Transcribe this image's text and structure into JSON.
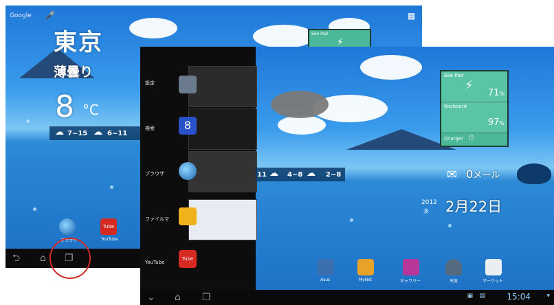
{
  "screenshot_a": {
    "search_label": "Google",
    "weather": {
      "city": "東京",
      "condition": "薄曇り",
      "temperature": "8",
      "unit": "°C",
      "forecast": [
        "7~15",
        "6~11"
      ]
    },
    "battery": {
      "title": "Eee Pad"
    },
    "dock": [
      {
        "label": "ブラウザ",
        "icon": "globe-icon"
      },
      {
        "label": "YouTube",
        "icon": "youtube-icon"
      }
    ],
    "nav": [
      "back-icon",
      "home-icon",
      "recent-apps-icon"
    ]
  },
  "screenshot_b": {
    "recent_apps": [
      {
        "label": "設定",
        "icon": "settings-icon"
      },
      {
        "label": "検索",
        "icon": "google-search-icon"
      },
      {
        "label": "ブラウザ",
        "icon": "globe-icon"
      },
      {
        "label": "ファイルマ",
        "icon": "folder-icon"
      },
      {
        "label": "YouTube",
        "icon": "youtube-icon"
      }
    ],
    "battery": {
      "title": "Eee Pad",
      "tablet_percent": "71",
      "keyboard_label": "Keyboard",
      "keyboard_percent": "97",
      "percent_symbol": "%",
      "charger_label": "Charger"
    },
    "weather_strip": [
      "11",
      "4~8",
      "2~8"
    ],
    "mail": {
      "count": "0",
      "label": "メール"
    },
    "date": {
      "year": "2012",
      "weekday": "水",
      "month_day": "2月22日"
    },
    "status_bar": {
      "time": "15:04"
    },
    "dock": [
      {
        "label": "Asus",
        "icon": "asus-icon"
      },
      {
        "label": "MyNet",
        "icon": "mynet-icon"
      },
      {
        "label": "ギャラリー",
        "icon": "gallery-icon"
      },
      {
        "label": "天気",
        "icon": "weather-icon"
      },
      {
        "label": "マーケット",
        "icon": "market-icon"
      }
    ]
  },
  "colors": {
    "highlight": "#d42a22",
    "widget": "#4bb89a",
    "sky": "#2c8ad7"
  }
}
